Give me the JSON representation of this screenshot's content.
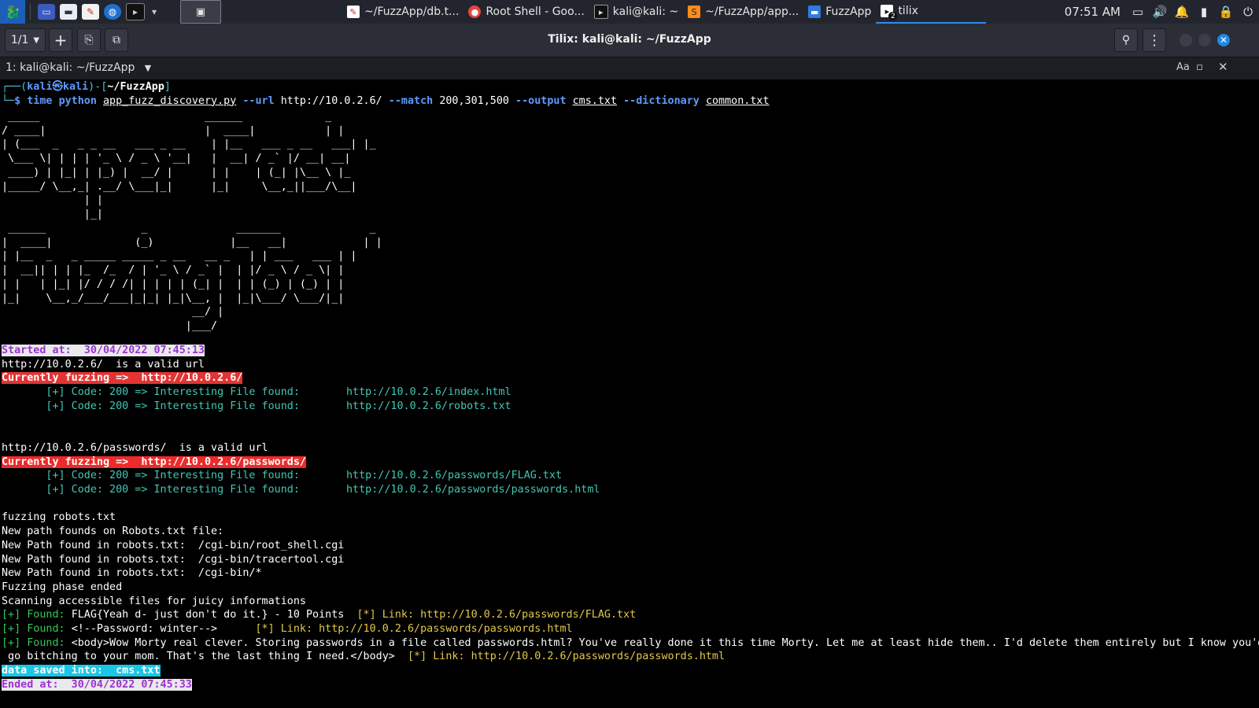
{
  "panel": {
    "launcher_icon": "kali-dragon-icon",
    "tasks": [
      {
        "icon": "text-editor-icon",
        "label": "~/FuzzApp/db.t..."
      },
      {
        "icon": "chrome-icon",
        "label": "Root Shell - Goo..."
      },
      {
        "icon": "terminal-icon",
        "label": "kali@kali: ~"
      },
      {
        "icon": "sublime-icon",
        "label": "~/FuzzApp/app..."
      },
      {
        "icon": "folder-icon",
        "label": "FuzzApp"
      },
      {
        "icon": "tilix-icon",
        "label": "tilix",
        "badge": "2"
      }
    ],
    "clock": "07:51 AM"
  },
  "header": {
    "tab_counter": "1/1",
    "title": "Tilix: kali@kali: ~/FuzzApp"
  },
  "session": {
    "title": "1: kali@kali: ~/FuzzApp"
  },
  "terminal": {
    "prompt": {
      "corner_top": "┌──(",
      "user_host": "kali㉿kali",
      "mid": ")-[",
      "dir": "~/FuzzApp",
      "end": "]",
      "corner_bottom": "└─",
      "dollar": "$ ",
      "cmd_time": "time ",
      "cmd_python": "python ",
      "script": "app_fuzz_discovery.py",
      "flag_url": " --url ",
      "url": "http://10.0.2.6/",
      "flag_match": " --match ",
      "match": "200,301,500",
      "flag_output": " --output ",
      "output": "cms.txt",
      "flag_dict": " --dictionary ",
      "dictionary": "common.txt"
    },
    "banner1": " _____                          ______             _\n/ ____|                         |  ____|           | |\n| (___  _   _ _ __   ___ _ __    | |__   ___ _ __   ___| |_\n \\___ \\| | | | '_ \\ / _ \\ '__|   |  __| / _` |/ __| __|\n ____) | |_| | |_) |  __/ |      | |    | (_| |\\__ \\ |_\n|_____/ \\__,_| .__/ \\___|_|      |_|     \\__,_||___/\\__|\n             | |\n             |_|",
    "banner2": " ______               _              _______              _\n|  ____|             (_)            |__   __|            | |\n| |__  _   _ _____ _____ _ __   __ _   | | ___   ___ | |\n|  __|| | | |_  /_  / | '_ \\ / _` |  | |/ _ \\ / _ \\| |\n| |   | |_| |/ / / /| | | | | (_| |  | | (_) | (_) | |\n|_|    \\__,_/___/___|_|_| |_|\\__, |  |_|\\___/ \\___/|_|\n                              __/ |\n                             |___/",
    "started": "Started at:  30/04/2022 07:45:13",
    "valid1": "http://10.0.2.6/  is a valid url",
    "fuzzing1": "Currently fuzzing =>  http://10.0.2.6/",
    "found1_prefix": "       [+] Code: 200 => Interesting File found:",
    "found1_url": "http://10.0.2.6/index.html",
    "found2_prefix": "       [+] Code: 200 => Interesting File found:",
    "found2_url": "http://10.0.2.6/robots.txt",
    "valid2": "http://10.0.2.6/passwords/  is a valid url",
    "fuzzing2": "Currently fuzzing =>  http://10.0.2.6/passwords/",
    "found3_prefix": "       [+] Code: 200 => Interesting File found:",
    "found3_url": "http://10.0.2.6/passwords/FLAG.txt",
    "found4_prefix": "       [+] Code: 200 => Interesting File found:",
    "found4_url": "http://10.0.2.6/passwords/passwords.html",
    "robots1": "fuzzing robots.txt",
    "robots2": "New path founds on Robots.txt file:",
    "robots3": "New Path found in robots.txt:  /cgi-bin/root_shell.cgi",
    "robots4": "New Path found in robots.txt:  /cgi-bin/tracertool.cgi",
    "robots5": "New Path found in robots.txt:  /cgi-bin/*",
    "phase_end": "Fuzzing phase ended",
    "scanning": "Scanning accessible files for juicy informations",
    "j1_found": "[+] Found: ",
    "j1_text": "FLAG{Yeah d- just don't do it.} - 10 Points  ",
    "j1_link": "[*] Link: http://10.0.2.6/passwords/FLAG.txt",
    "j2_found": "[+] Found: ",
    "j2_text": "<!--Password: winter-->      ",
    "j2_link": "[*] Link: http://10.0.2.6/passwords/passwords.html",
    "j3_found": "[+] Found: ",
    "j3_text": "<body>Wow Morty real clever. Storing passwords in a file called passwords.html? You've really done it this time Morty. Let me at least hide them.. I'd delete them entirely but I know you'd",
    "j3_text2": " go bitching to your mom. That's the last thing I need.</body>  ",
    "j3_link": "[*] Link: http://10.0.2.6/passwords/passwords.html",
    "saved": "data saved into:  cms.txt",
    "ended": "Ended at:  30/04/2022 07:45:33"
  },
  "colors": {
    "terminal_bg": "#000000",
    "prompt_blue": "#5e9bff",
    "highlight_red": "#e33434",
    "highlight_cyan": "#18c7e6",
    "found_teal": "#43c6b3",
    "link_yellow": "#e3c84b",
    "accent": "#1e88e5"
  }
}
